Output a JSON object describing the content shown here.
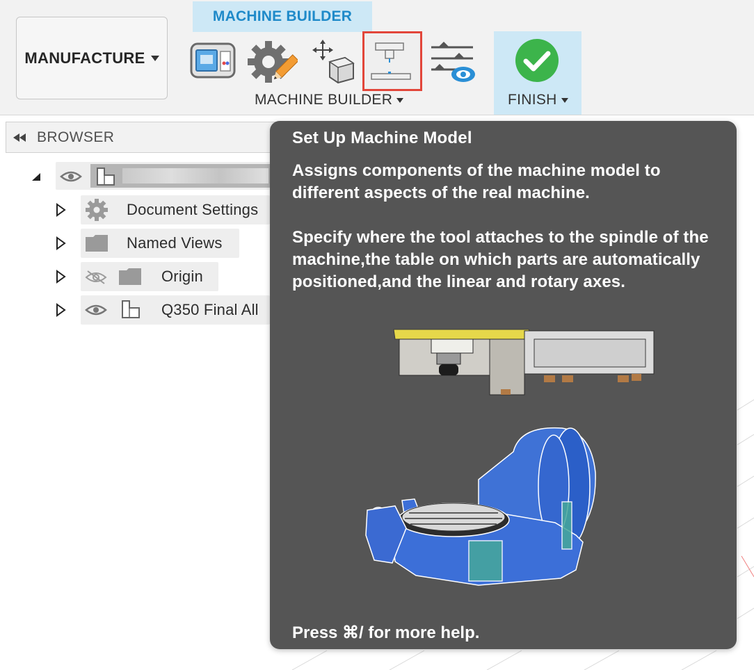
{
  "toolbar": {
    "workspace_label": "MANUFACTURE",
    "tab_label": "MACHINE BUILDER",
    "group_label": "MACHINE BUILDER",
    "finish_label": "FINISH",
    "icons": [
      "machine-icon",
      "machine-settings-icon",
      "move-component-icon",
      "set-up-machine-model-icon",
      "machine-simulation-icon",
      "finish-check-icon"
    ]
  },
  "browser": {
    "title": "BROWSER",
    "items": [
      {
        "label": "Document Settings",
        "icon": "gear-icon"
      },
      {
        "label": "Named Views",
        "icon": "folder-icon"
      },
      {
        "label": "Origin",
        "icon": "folder-icon"
      },
      {
        "label": "Q350 Final All",
        "icon": "component-icon"
      }
    ]
  },
  "tooltip": {
    "title": "Set Up Machine Model",
    "description": "Assigns components of the machine model to different aspects of the real machine.\n\nSpecify where the tool attaches to the spindle of the machine,the table on which parts are automatically positioned,and the linear and rotary axes.",
    "help": "Press ⌘/ for more help."
  },
  "colors": {
    "accent": "#1f8ac9",
    "tab_bg": "#cde8f6",
    "highlight": "#e2463a",
    "tooltip_bg": "#555555",
    "finish_green": "#3cb44b"
  }
}
